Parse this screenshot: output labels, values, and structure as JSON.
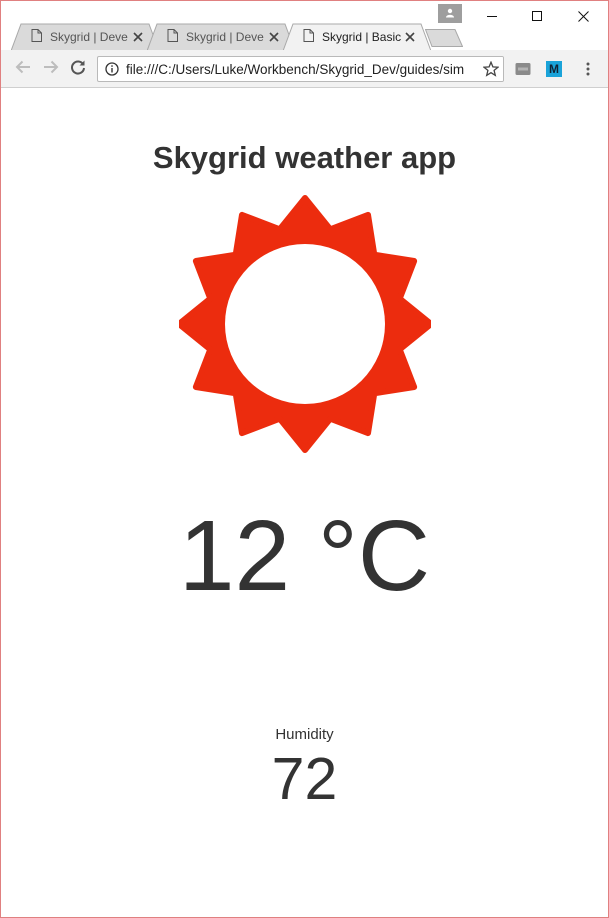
{
  "browser": {
    "tabs": [
      {
        "title": "Skygrid | Deve",
        "active": false
      },
      {
        "title": "Skygrid | Deve",
        "active": false
      },
      {
        "title": "Skygrid | Basic",
        "active": true
      }
    ],
    "url": "file:///C:/Users/Luke/Workbench/Skygrid_Dev/guides/sim",
    "icons": {
      "profile": "profile-icon",
      "minimize": "minimize-icon",
      "maximize": "maximize-icon",
      "close": "close-icon",
      "back": "back-arrow-icon",
      "forward": "forward-arrow-icon",
      "reload": "reload-icon",
      "info": "info-icon",
      "bookmark": "star-icon",
      "extension1": "extension-icon",
      "extension2": "m-extension-icon",
      "menu": "kebab-menu-icon"
    },
    "extension2_label": "M"
  },
  "app": {
    "title": "Skygrid weather app",
    "weather_icon": "sun-icon",
    "sun_color": "#ec2c0e",
    "temperature": "12 °C",
    "humidity_label": "Humidity",
    "humidity_value": "72"
  }
}
